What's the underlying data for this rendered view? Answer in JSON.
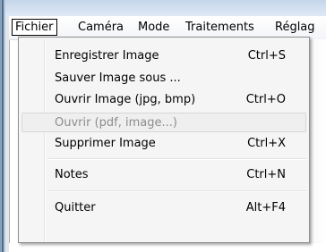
{
  "menubar": {
    "items": [
      {
        "label": "Fichier"
      },
      {
        "label": "Caméra"
      },
      {
        "label": "Mode"
      },
      {
        "label": "Traitements"
      },
      {
        "label": "Réglag"
      }
    ]
  },
  "fichier_menu": {
    "items": [
      {
        "label": "Enregistrer Image",
        "shortcut": "Ctrl+S",
        "enabled": true
      },
      {
        "label": "Sauver Image sous ...",
        "shortcut": "",
        "enabled": true
      },
      {
        "label": "Ouvrir Image (jpg, bmp)",
        "shortcut": "Ctrl+O",
        "enabled": true
      },
      {
        "label": "Ouvrir  (pdf, image...)",
        "shortcut": "",
        "enabled": false
      },
      {
        "label": "Supprimer Image",
        "shortcut": "Ctrl+X",
        "enabled": true
      },
      {
        "label": "Notes",
        "shortcut": "Ctrl+N",
        "enabled": true
      },
      {
        "label": "Quitter",
        "shortcut": "Alt+F4",
        "enabled": true
      }
    ]
  },
  "colors": {
    "disabled_text": "#8d8d8d",
    "menu_background": "#f5f5f5",
    "menu_border": "#8e8f8f"
  }
}
